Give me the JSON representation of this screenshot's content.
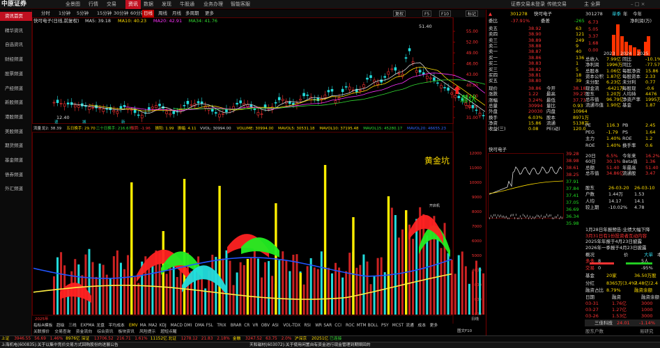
{
  "window": {
    "logo": "中原证券",
    "menu": [
      "全景图",
      "行情",
      "交易",
      "资讯",
      "数据",
      "发现",
      "牛股通",
      "业务办理",
      "智能客服"
    ],
    "menu_active": 3,
    "top_right": [
      "证券交易未登录",
      "传统交易",
      "主 全屏"
    ]
  },
  "sidebar": {
    "items": [
      "资讯首页",
      "精华资讯",
      "自选资讯",
      "财经频道",
      "股票频道",
      "产经频道",
      "新股频道",
      "港股频道",
      "美股频道",
      "期货频道",
      "基金频道",
      "债券频道",
      "外汇频道"
    ],
    "active": 0
  },
  "chart_toolbar": {
    "tabs": [
      "分时",
      "1分钟",
      "5分钟",
      "15分钟",
      "30分钟",
      "60分钟",
      "日线",
      "周线",
      "月线",
      "多周期",
      "更多"
    ],
    "active": 6,
    "title": "快可电子(日线,前复权)",
    "ma_labels": [
      {
        "t": "MA5: 39.18",
        "c": "#dddddd"
      },
      {
        "t": "MA10: 40.23",
        "c": "#ffdd00"
      },
      {
        "t": "MA20: 42.91",
        "c": "#ff33ff"
      },
      {
        "t": "MA34: 41.76",
        "c": "#33dd33"
      }
    ],
    "right_buttons": [
      "复权",
      "F5",
      "F10",
      "标记"
    ]
  },
  "main_chart": {
    "y_ticks": [
      "55.00",
      "52.00",
      "49.00",
      "46.00",
      "43.00",
      "40.00",
      "37.00",
      "34.00",
      "31.00"
    ],
    "high_label": "51.40",
    "low_label": "12.40",
    "qianfu": "潜伏",
    "marks": [
      "退",
      "城",
      "新"
    ]
  },
  "volume_bar": {
    "items": [
      {
        "t": "流量",
        "c": "#dddddd"
      },
      {
        "t": "龙2: 38.39",
        "c": "#dddddd"
      },
      {
        "t": "五日换手: 29.70",
        "c": "#ffdd00"
      },
      {
        "t": "二十日换手: 216.67",
        "c": "#33dd33"
      },
      {
        "t": "振阴: -1.96",
        "c": "#ff3333"
      },
      {
        "t": "振阳: 1.99",
        "c": "#ffdd00"
      },
      {
        "t": "振幅: 4.11",
        "c": "#ffdd00"
      },
      {
        "t": "VVOL: 30994.00",
        "c": "#dddddd"
      },
      {
        "t": "VOLUME: 30994.00",
        "c": "#ffdd00"
      },
      {
        "t": "MAVOL5: 30531.18",
        "c": "#ffdd00"
      },
      {
        "t": "MAVOL10: 37195.48",
        "c": "#ffdd00"
      },
      {
        "t": "MAVOL15: 45280.17",
        "c": "#33dd33"
      },
      {
        "t": "MAVOL20: 46655.23",
        "c": "#3366ff"
      }
    ]
  },
  "indicator_chart": {
    "title": "黄金坑",
    "tag": "开启机",
    "y_ticks": [
      "12000",
      "11000",
      "10000",
      "9000",
      "8000",
      "7000",
      "6000",
      "5000",
      "4000",
      "3000",
      "2000",
      "1000"
    ]
  },
  "date_axis": {
    "year": "2025年",
    "date_end": "图文F10",
    "day": "日线"
  },
  "indicator_tabs": [
    "指标A",
    "模板",
    "超级",
    "三线",
    "EXPMA",
    "龙盘",
    "平均成本",
    "EMV",
    "MA",
    "MA2",
    "KDJ",
    "MACD",
    "DMI",
    "DMA",
    "FSL",
    "TRIX",
    "BRAR",
    "CR",
    "VR",
    "OBV",
    "ASI",
    "VOL-TDX",
    "RSI",
    "WR",
    "SAR",
    "CCI",
    "ROC",
    "MTM",
    "BOLL",
    "PSY",
    "MCST",
    "流通",
    "成本",
    "更多"
  ],
  "bottom_tabs": [
    "关联报价",
    "交易查询",
    "资金流向",
    "综合资讯",
    "板块资讯",
    "风险提示",
    "超短点醒"
  ],
  "quote": {
    "code": "301278",
    "name": "快可电子",
    "weibi_label": "委比",
    "weibi": "-37.91%",
    "weicha_label": "委差",
    "weicha": "-265",
    "sell": [
      {
        "l": "卖五",
        "p": "38.92",
        "v": "63"
      },
      {
        "l": "卖四",
        "p": "38.90",
        "v": "121"
      },
      {
        "l": "卖三",
        "p": "38.89",
        "v": "249"
      },
      {
        "l": "卖二",
        "p": "38.88",
        "v": "9"
      },
      {
        "l": "卖一",
        "p": "38.87",
        "v": "40"
      }
    ],
    "buy": [
      {
        "l": "买一",
        "p": "38.86",
        "v": "136"
      },
      {
        "l": "买二",
        "p": "38.83",
        "v": "1"
      },
      {
        "l": "买三",
        "p": "38.82",
        "v": "5"
      },
      {
        "l": "买四",
        "p": "38.81",
        "v": "18"
      },
      {
        "l": "买五",
        "p": "38.80",
        "v": "39"
      }
    ],
    "stats": [
      [
        "现价",
        "38.86",
        "今开",
        "38.18"
      ],
      [
        "涨跌",
        "1.22",
        "最高",
        "39.27"
      ],
      [
        "涨幅",
        "3.24%",
        "最低",
        "37.73"
      ],
      [
        "总量",
        "30994",
        "量比",
        "0.93"
      ],
      [
        "外盘",
        "20030",
        "内盘",
        "10964"
      ],
      [
        "换手",
        "6.03%",
        "股本",
        "8971万"
      ],
      [
        "净资",
        "15.86",
        "流通",
        "5138万"
      ],
      [
        "收益(三)",
        "0.08",
        "PE(动)",
        "120.0"
      ]
    ]
  },
  "finance": {
    "code": "301278",
    "tabs": [
      "单季",
      "年",
      "今年",
      "净利润(万)"
    ],
    "values": [
      "6.73",
      "5.05",
      "3.37",
      "1.68",
      "0.00"
    ],
    "years": [
      "2023",
      "2024",
      "2025"
    ],
    "rows": [
      [
        "总收入",
        "7.99亿",
        "同比",
        "-10.1%"
      ],
      [
        "净利润",
        "1996万",
        "同比",
        "-77.57"
      ],
      [
        "总股本",
        "1.06亿",
        "每股净资",
        "15.86"
      ],
      [
        "资本公积",
        "1.87亿",
        "每股资本",
        "2.33"
      ],
      [
        "未分配",
        "6.23亿",
        "未分利",
        "0.77"
      ],
      [
        "现金流",
        "-6421万",
        "每股现",
        "-0.6"
      ],
      [
        "股东",
        "1.20万",
        "人均持",
        "4476"
      ],
      [
        "总市值",
        "96.79亿",
        "净资产率",
        "1995万"
      ],
      [
        "流通市值",
        "1.90亿",
        "基金",
        "1.87"
      ]
    ]
  },
  "valuation": [
    [
      "PE",
      "116.3",
      "PB",
      "2.45"
    ],
    [
      "PEG",
      "-1.79",
      "PS",
      "1.64"
    ],
    [
      "主力",
      "1.40%",
      "ROE",
      "1.2"
    ],
    [
      "ROE",
      "1.40%",
      "换手率",
      "0.6"
    ]
  ],
  "mini": {
    "name": "快可电子",
    "y": [
      "39.28",
      "38.98",
      "38.61",
      "38.25",
      "37.91",
      "37.84",
      "37.41",
      "37.05",
      "36.69",
      "36.34",
      "35.98"
    ]
  },
  "ranges": [
    [
      "20日",
      "6.5%",
      "今年来",
      "16.2%"
    ],
    [
      "60日",
      "30.1%",
      "Beta值",
      "1.36"
    ],
    [
      "总额",
      "51.40",
      "年最高",
      "51.40"
    ],
    [
      "总市值",
      "34.86亿",
      "流通股",
      "3.47"
    ]
  ],
  "dates": [
    [
      "股东",
      "26-03-20",
      "26-03-10"
    ],
    [
      "户数",
      "1.44万",
      "1.53"
    ],
    [
      "人均",
      "14.17",
      "14.1"
    ],
    [
      "较上期",
      "-10.02%",
      "4.78"
    ]
  ],
  "news": [
    "1月28日年报预告:业绩大幅下降",
    "3月31日有1份投资者互动内容",
    "2025年年报于4月23日披露",
    "2026年一季报于4月23日披露"
  ],
  "news_tabs": [
    "概况",
    "价",
    "大单",
    "本年"
  ],
  "hot": [
    [
      "多多",
      "8",
      "9人",
      "5人",
      "8"
    ],
    [
      "交易",
      "0",
      "5%",
      "-95%",
      "0"
    ]
  ],
  "kv": [
    [
      "基金",
      "20家",
      "36.50万股",
      "0.7"
    ],
    [
      "分红",
      "8365万(3.4%)",
      "7.48亿(2.4"
    ],
    [
      "融资占比",
      "8.79%",
      "融资余额",
      "8.25"
    ]
  ],
  "flow": [
    [
      "日期",
      "融资",
      "融资余额"
    ],
    [
      "03-31",
      "1.76亿",
      "3000"
    ],
    [
      "03-27",
      "1.27亿",
      "1000"
    ],
    [
      "03-26",
      "1.53亿",
      "3000"
    ]
  ],
  "sector": {
    "name": "三佳科技",
    "v1": "24.01",
    "v2": "-1.14%",
    "note": "股东户数",
    "extra": "易研究"
  },
  "status1": [
    {
      "t": "上证",
      "c": "#ffdd00"
    },
    {
      "t": "3946.55",
      "c": "#ff3333"
    },
    {
      "t": "56.69",
      "c": "#ff3333"
    },
    {
      "t": "1.46%",
      "c": "#ff3333"
    },
    {
      "t": "8976亿",
      "c": "#ffdd00"
    },
    {
      "t": "深证",
      "c": "#ffdd00"
    },
    {
      "t": "13706.52",
      "c": "#ff3333"
    },
    {
      "t": "216.71",
      "c": "#ff3333"
    },
    {
      "t": "1.61%",
      "c": "#ff3333"
    },
    {
      "t": "11152亿",
      "c": "#ffdd00"
    },
    {
      "t": "北证",
      "c": "#ffdd00"
    },
    {
      "t": "1278.12",
      "c": "#ff3333"
    },
    {
      "t": "21.83",
      "c": "#ff3333"
    },
    {
      "t": "2.18%",
      "c": "#ff3333"
    },
    {
      "t": "金融",
      "c": "#ffdd00"
    },
    {
      "t": "3247.52",
      "c": "#ff3333"
    },
    {
      "t": "63.75",
      "c": "#ff3333"
    },
    {
      "t": "2.0%",
      "c": "#ff3333"
    },
    {
      "t": "沪深京",
      "c": "#ffdd00"
    },
    {
      "t": "20251亿",
      "c": "#ffdd00"
    },
    {
      "t": "已连接",
      "c": "#33dd33"
    }
  ],
  "status2": [
    "上海机电(600835):关于以集中竞价交易方式回购股份的进展公告",
    "天和磁材(603072):关于使用闲置自有资金进行现金管理到期赎回的"
  ]
}
